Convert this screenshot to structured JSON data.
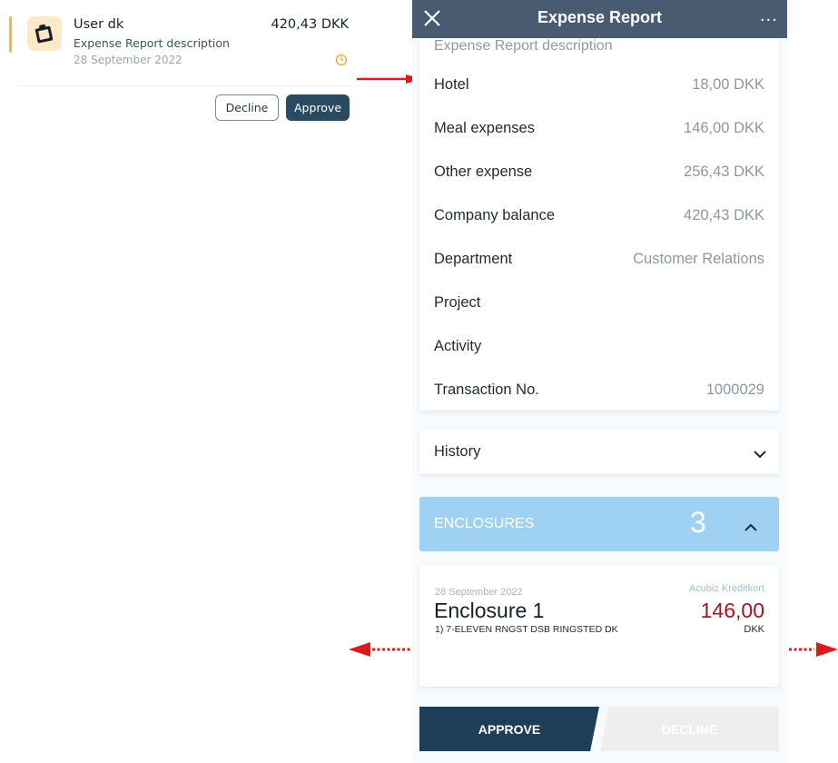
{
  "left_card": {
    "user_name": "User dk",
    "amount": "420,43 DKK",
    "description": "Expense Report description",
    "date": "28 September 2022",
    "icon": "clipboard-icon",
    "status_icon": "clock-icon",
    "decline_label": "Decline",
    "approve_label": "Approve"
  },
  "phone": {
    "title": "Expense Report",
    "close_icon": "close-icon",
    "more_icon": "more-icon",
    "more_label": "···",
    "description": "Expense Report description",
    "details": [
      {
        "label": "Hotel",
        "value": "18,00 DKK"
      },
      {
        "label": "Meal expenses",
        "value": "146,00 DKK"
      },
      {
        "label": "Other expense",
        "value": "256,43 DKK"
      },
      {
        "label": "Company balance",
        "value": "420,43 DKK"
      },
      {
        "label": "Department",
        "value": "Customer Relations"
      },
      {
        "label": "Project",
        "value": ""
      },
      {
        "label": "Activity",
        "value": ""
      },
      {
        "label": "Transaction No.",
        "value": "1000029"
      }
    ],
    "history_label": "History",
    "enclosures": {
      "label": "ENCLOSURES",
      "count": "3",
      "items": [
        {
          "date": "28 September 2022",
          "source": "Acubiz Kreditkort",
          "title": "Enclosure 1",
          "line": "1)  7-ELEVEN RNGST DSB RINGSTED DK",
          "amount": "146,00",
          "currency": "DKK"
        }
      ]
    },
    "approve_label": "APPROVE",
    "decline_label": "DECLINE"
  },
  "colors": {
    "navbar": "#485b70",
    "enclosures_header": "#9fd1f2",
    "approve": "#1e3e58",
    "amount_red": "#a3141e",
    "arrow_red": "#e01818"
  }
}
